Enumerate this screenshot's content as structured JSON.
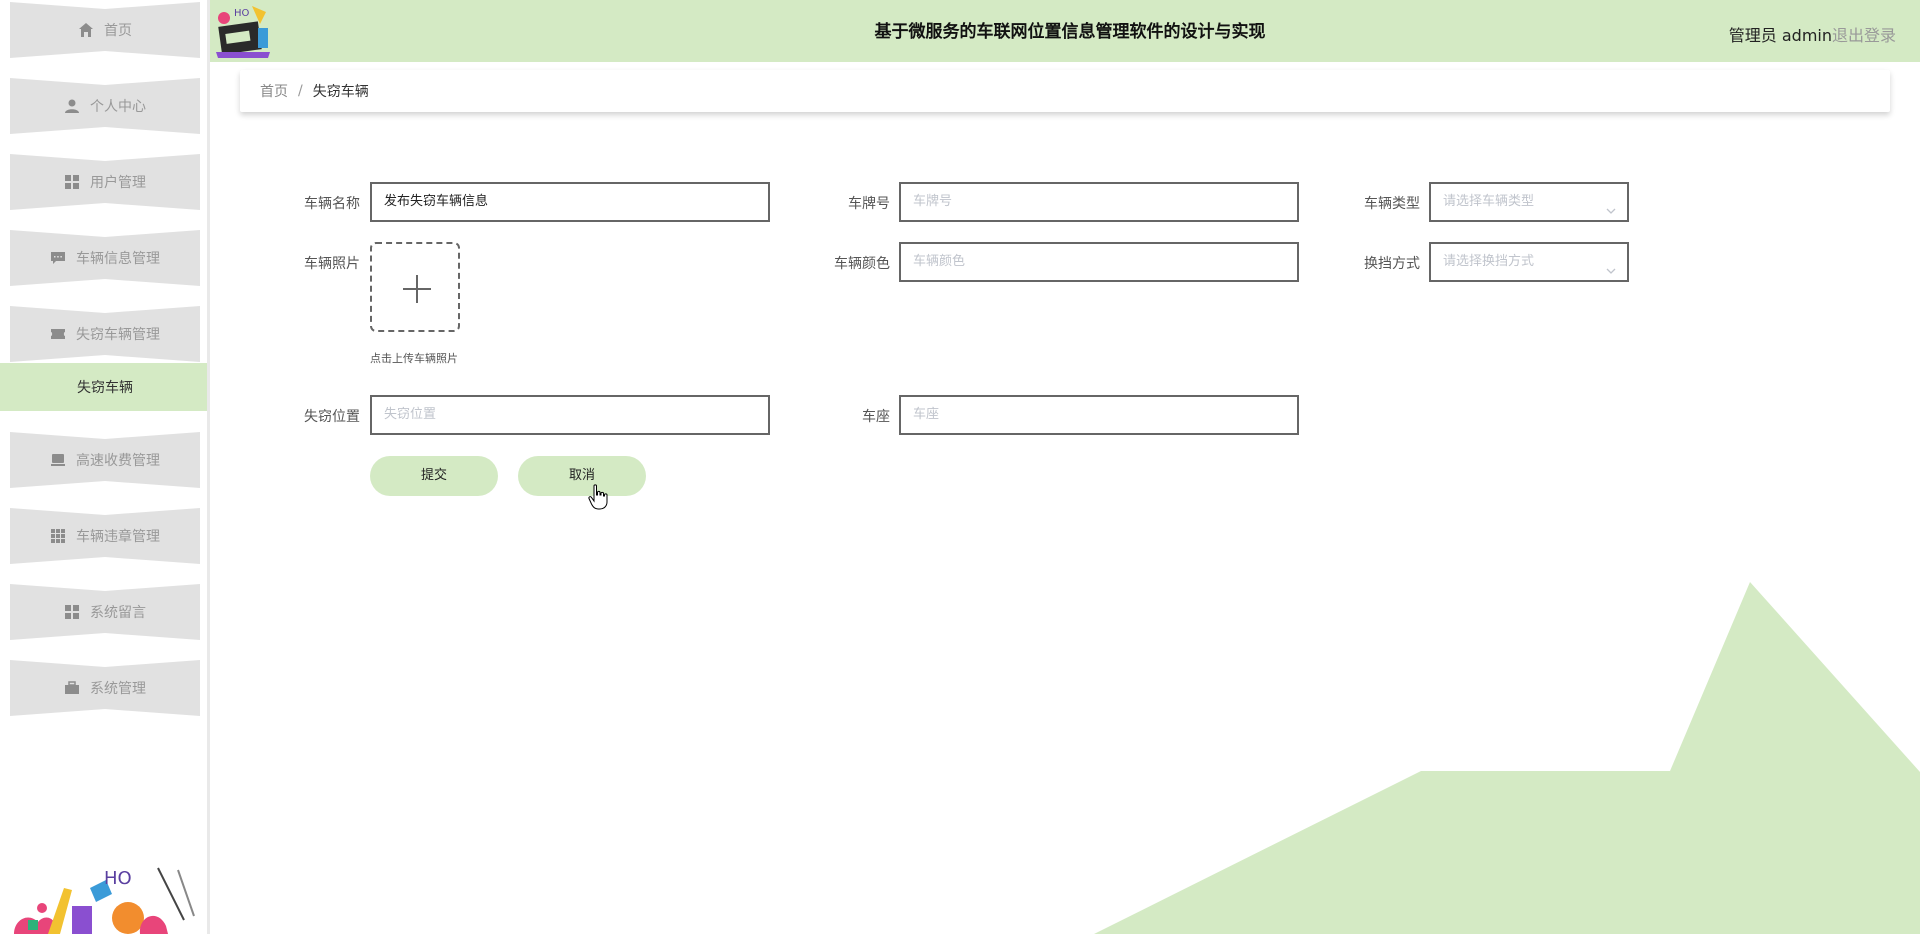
{
  "header": {
    "title": "基于微服务的车联网位置信息管理软件的设计与实现",
    "user": "管理员 admin",
    "logout": "退出登录"
  },
  "sidebar": {
    "items": [
      {
        "label": "首页",
        "icon": "home-icon"
      },
      {
        "label": "个人中心",
        "icon": "user-icon"
      },
      {
        "label": "用户管理",
        "icon": "grid-icon"
      },
      {
        "label": "车辆信息管理",
        "icon": "message-icon"
      },
      {
        "label": "失窃车辆管理",
        "icon": "ticket-icon"
      },
      {
        "label": "高速收费管理",
        "icon": "monitor-icon"
      },
      {
        "label": "车辆违章管理",
        "icon": "apps-icon"
      },
      {
        "label": "系统留言",
        "icon": "grid-icon"
      },
      {
        "label": "系统管理",
        "icon": "briefcase-icon"
      }
    ],
    "active_sub": "失窃车辆"
  },
  "breadcrumb": {
    "home": "首页",
    "separator": "/",
    "current": "失窃车辆"
  },
  "form": {
    "vehicle_name": {
      "label": "车辆名称",
      "value": "发布失窃车辆信息"
    },
    "plate": {
      "label": "车牌号",
      "placeholder": "车牌号"
    },
    "vehicle_type": {
      "label": "车辆类型",
      "placeholder": "请选择车辆类型"
    },
    "photo": {
      "label": "车辆照片",
      "tip": "点击上传车辆照片"
    },
    "color": {
      "label": "车辆颜色",
      "placeholder": "车辆颜色"
    },
    "gear": {
      "label": "换挡方式",
      "placeholder": "请选择换挡方式"
    },
    "location": {
      "label": "失窃位置",
      "placeholder": "失窃位置"
    },
    "seats": {
      "label": "车座",
      "placeholder": "车座"
    },
    "submit": "提交",
    "cancel": "取消"
  },
  "colors": {
    "accent": "#d4eac4",
    "sidebar_item": "#e1e1e1",
    "deco_shape": "#d4eac4"
  }
}
